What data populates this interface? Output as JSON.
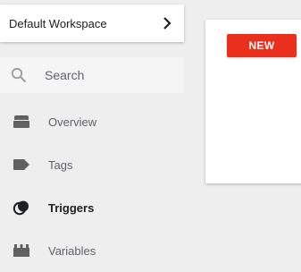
{
  "workspace": {
    "label": "Default Workspace",
    "chevron_icon": "chevron-right-icon"
  },
  "search": {
    "placeholder": "Search",
    "value": "",
    "icon": "search-icon"
  },
  "nav": {
    "items": [
      {
        "label": "Overview",
        "icon": "overview-icon",
        "active": false
      },
      {
        "label": "Tags",
        "icon": "tag-icon",
        "active": false
      },
      {
        "label": "Triggers",
        "icon": "triggers-icon",
        "active": true
      },
      {
        "label": "Variables",
        "icon": "variables-icon",
        "active": false
      }
    ]
  },
  "panel": {
    "new_label": "NEW"
  },
  "colors": {
    "accent": "#ea2f1d",
    "sidebar_bg": "#eeeeee",
    "icon_gray": "#616161",
    "active_text": "#202124"
  }
}
